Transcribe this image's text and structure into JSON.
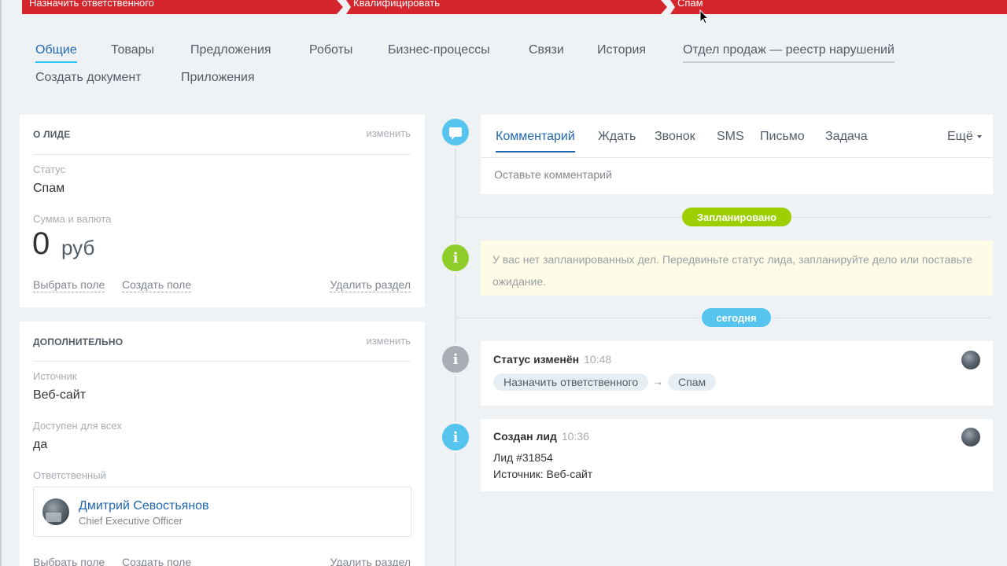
{
  "stages": [
    {
      "label": "Назначить ответственного"
    },
    {
      "label": "Квалифицировать"
    },
    {
      "label": "Спам"
    }
  ],
  "tabs": {
    "row1": [
      "Общие",
      "Товары",
      "Предложения",
      "Роботы",
      "Бизнес-процессы",
      "Связи",
      "История",
      "Отдел продаж — реестр нарушений"
    ],
    "row2": [
      "Создать документ",
      "Приложения"
    ]
  },
  "about_lead": {
    "title": "О ЛИДЕ",
    "edit": "изменить",
    "status_label": "Статус",
    "status_value": "Спам",
    "amount_label": "Сумма и валюта",
    "amount_value": "0",
    "currency": "руб",
    "select_field": "Выбрать поле",
    "create_field": "Создать поле",
    "delete_section": "Удалить раздел"
  },
  "additional": {
    "title": "ДОПОЛНИТЕЛЬНО",
    "edit": "изменить",
    "source_label": "Источник",
    "source_value": "Веб-сайт",
    "available_label": "Доступен для всех",
    "available_value": "да",
    "responsible_label": "Ответственный",
    "responsible_name": "Дмитрий Севостьянов",
    "responsible_position": "Chief Executive Officer",
    "select_field": "Выбрать поле",
    "create_field": "Создать поле",
    "delete_section": "Удалить раздел"
  },
  "activity": {
    "tabs": [
      "Комментарий",
      "Ждать",
      "Звонок",
      "SMS",
      "Письмо",
      "Задача"
    ],
    "more": "Ещё",
    "placeholder": "Оставьте комментарий"
  },
  "timeline": {
    "planned_badge": "Запланировано",
    "planned_notice": "У вас нет запланированных дел. Передвиньте статус лида, запланируйте дело или поставьте ожидание.",
    "today_badge": "сегодня",
    "events": [
      {
        "title": "Статус изменён",
        "time": "10:48",
        "from": "Назначить ответственного",
        "arrow": "→",
        "to": "Спам"
      },
      {
        "title": "Создан лид",
        "time": "10:36",
        "line1": "Лид #31854",
        "line2": "Источник: Веб-сайт"
      }
    ]
  },
  "colors": {
    "stage_red": "#d6262d",
    "link_blue": "#2067b0",
    "accent_cyan": "#2fc6f6",
    "planned_green": "#9dcf00",
    "today_blue": "#55c4ef"
  }
}
